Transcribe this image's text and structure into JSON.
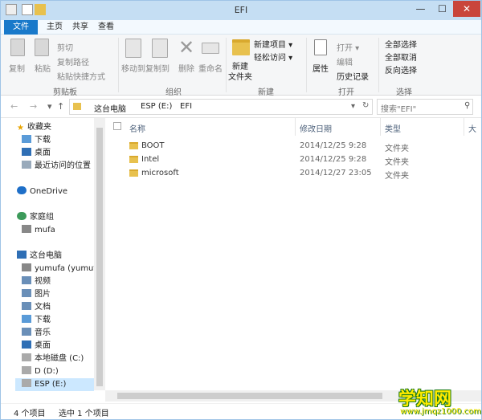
{
  "window": {
    "title": "EFI",
    "min": "—",
    "max": "☐",
    "close": "✕"
  },
  "tabs": [
    "文件",
    "主页",
    "共享",
    "查看"
  ],
  "ribbon": {
    "copy": "复制",
    "paste": "粘贴",
    "cut": "剪切",
    "copy_path": "复制路径",
    "paste_shortcut": "粘贴快捷方式",
    "group_clipboard": "剪贴板",
    "move_to": "移动到",
    "copy_to": "复制到",
    "delete": "删除",
    "rename": "重命名",
    "group_organize": "组织",
    "new_folder_1": "新建",
    "new_folder_2": "文件夹",
    "new_item": "新建项目 ▾",
    "easy_access": "轻松访问 ▾",
    "group_new": "新建",
    "properties": "属性",
    "open": "打开 ▾",
    "edit": "编辑",
    "history": "历史记录",
    "group_open": "打开",
    "select_all": "全部选择",
    "select_none": "全部取消",
    "invert": "反向选择",
    "group_select": "选择"
  },
  "address": {
    "back": "←",
    "forward": "→",
    "recent": "▾",
    "up": "↑",
    "crumbs": [
      "这台电脑",
      "ESP (E:)",
      "EFI"
    ],
    "dropdown": "▾",
    "refresh": "↻",
    "search_placeholder": "搜索\"EFI\""
  },
  "nav": {
    "favorites": "收藏夹",
    "downloads": "下载",
    "desktop": "桌面",
    "recent": "最近访问的位置",
    "onedrive": "OneDrive",
    "homegroup": "家庭组",
    "user": "mufa",
    "thispc": "这台电脑",
    "pc_user": "yumufa (yumufa",
    "videos": "视频",
    "pictures": "图片",
    "docs": "文档",
    "downloads2": "下载",
    "music": "音乐",
    "desktop2": "桌面",
    "disk_c": "本地磁盘 (C:)",
    "disk_d": "D (D:)",
    "disk_e": "ESP (E:)"
  },
  "columns": {
    "name": "名称",
    "modified": "修改日期",
    "type": "类型",
    "size": "大"
  },
  "files": [
    {
      "name": "BOOT",
      "date": "2014/12/25 9:28",
      "type": "文件夹"
    },
    {
      "name": "Intel",
      "date": "2014/12/25 9:28",
      "type": "文件夹"
    },
    {
      "name": "microsoft",
      "date": "2014/12/27 23:05",
      "type": "文件夹"
    }
  ],
  "status": {
    "count": "4 个项目",
    "selected": "选中 1 个项目"
  },
  "watermark": {
    "brand": "学知网",
    "url": "www.jmqz1000.com"
  },
  "colors": {
    "accent": "#1979ca",
    "titlebar": "#c5def3",
    "close": "#c9453b"
  }
}
